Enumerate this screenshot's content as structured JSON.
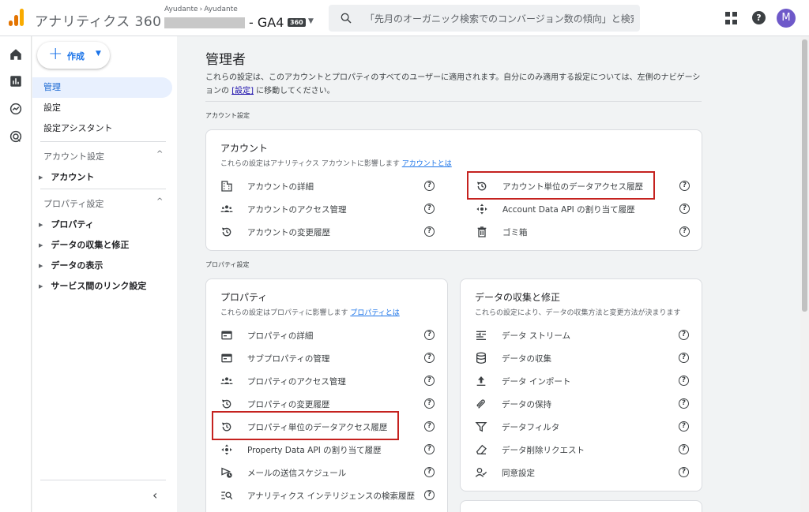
{
  "header": {
    "app_name": "アナリティクス 360",
    "breadcrumb_account": "Ayudante",
    "breadcrumb_property": "Ayudante",
    "breadcrumb_sep": "›",
    "property_name": "- GA4",
    "badge": "360",
    "caret": "▼",
    "search_placeholder": "「先月のオーガニック検索でのコンバージョン数の傾向」と検索…",
    "help": "?",
    "avatar_initial": "M"
  },
  "nav": {
    "create_label": "作成",
    "create_plus": "+",
    "create_caret": "▼",
    "items": [
      {
        "label": "管理"
      },
      {
        "label": "設定"
      },
      {
        "label": "設定アシスタント"
      }
    ],
    "account_section": "アカウント設定",
    "account_sub": [
      "アカウント"
    ],
    "property_section": "プロパティ設定",
    "property_sub": [
      "プロパティ",
      "データの収集と修正",
      "データの表示",
      "サービス間のリンク設定"
    ],
    "section_caret": "^",
    "tri": "▶",
    "collapse": "‹"
  },
  "main": {
    "title": "管理者",
    "intro_text": "これらの設定は、このアカウントとプロパティのすべてのユーザーに適用されます。自分にのみ適用する設定については、左側のナビゲーションの ",
    "intro_link": "[設定]",
    "intro_end": " に移動してください。",
    "account_section_label": "アカウント設定",
    "property_section_label": "プロパティ設定",
    "help": "?",
    "account_card": {
      "title": "アカウント",
      "desc": "これらの設定はアナリティクス アカウントに影響します ",
      "desc_link": "アカウントとは",
      "left_rows": [
        {
          "icon": "building-icon",
          "label": "アカウントの詳細"
        },
        {
          "icon": "people-icon",
          "label": "アカウントのアクセス管理"
        },
        {
          "icon": "history-icon",
          "label": "アカウントの変更履歴"
        }
      ],
      "right_rows": [
        {
          "icon": "history-icon",
          "label": "アカウント単位のデータアクセス履歴"
        },
        {
          "icon": "api-icon",
          "label": "Account Data API の割り当て履歴"
        },
        {
          "icon": "trash-icon",
          "label": "ゴミ箱"
        }
      ]
    },
    "property_card": {
      "title": "プロパティ",
      "desc": "これらの設定はプロパティに影響します ",
      "desc_link": "プロパティとは",
      "rows": [
        {
          "icon": "card-icon",
          "label": "プロパティの詳細"
        },
        {
          "icon": "card-icon",
          "label": "サブプロパティの管理"
        },
        {
          "icon": "people-icon",
          "label": "プロパティのアクセス管理"
        },
        {
          "icon": "history-icon",
          "label": "プロパティの変更履歴"
        },
        {
          "icon": "history-icon",
          "label": "プロパティ単位のデータアクセス履歴"
        },
        {
          "icon": "api-icon",
          "label": "Property Data API の割り当て履歴"
        },
        {
          "icon": "schedule-send-icon",
          "label": "メールの送信スケジュール"
        },
        {
          "icon": "search-history-icon",
          "label": "アナリティクス インテリジェンスの検索履歴"
        }
      ]
    },
    "data_card": {
      "title": "データの収集と修正",
      "desc": "これらの設定により、データの収集方法と変更方法が決まります",
      "rows": [
        {
          "icon": "stream-icon",
          "label": "データ ストリーム"
        },
        {
          "icon": "database-icon",
          "label": "データの収集"
        },
        {
          "icon": "upload-icon",
          "label": "データ インポート"
        },
        {
          "icon": "retention-icon",
          "label": "データの保持"
        },
        {
          "icon": "filter-icon",
          "label": "データフィルタ"
        },
        {
          "icon": "eraser-icon",
          "label": "データ削除リクエスト"
        },
        {
          "icon": "consent-icon",
          "label": "同意設定"
        }
      ]
    }
  },
  "colors": {
    "accent": "#1a73e8",
    "highlight": "#c5221f",
    "avatar": "#6e59c9"
  }
}
